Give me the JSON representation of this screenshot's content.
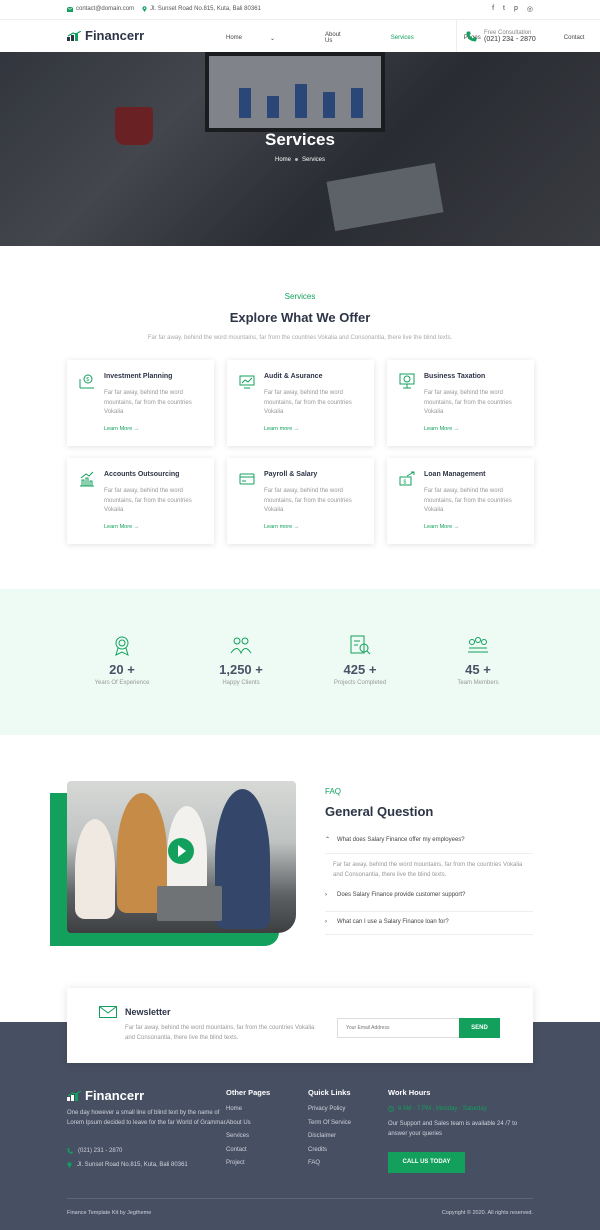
{
  "topbar": {
    "email": "contact@domain.com",
    "address": "Jl. Sunset Road No.815, Kuta, Bali 80361",
    "social": [
      "facebook-icon",
      "twitter-icon",
      "pinterest-icon",
      "instagram-icon"
    ],
    "social_glyphs": [
      "f",
      "t",
      "p",
      "◎"
    ]
  },
  "nav": {
    "logo": "Financerr",
    "items": [
      {
        "label": "Home",
        "dropdown": true
      },
      {
        "label": "About Us",
        "dropdown": false
      },
      {
        "label": "Services",
        "dropdown": false
      },
      {
        "label": "Pages",
        "dropdown": true
      },
      {
        "label": "Contact",
        "dropdown": true
      }
    ],
    "consult_label": "Free Consultation",
    "consult_phone": "(021) 231 - 2870"
  },
  "hero": {
    "title": "Services",
    "breadcrumb": [
      "Home",
      "Services"
    ]
  },
  "services": {
    "tag": "Services",
    "title": "Explore What We Offer",
    "subtitle": "Far far away, behind the word mountains, far from the countries Vokalia and Consonantia, there live the blind texts.",
    "cards": [
      {
        "title": "Investment Planning",
        "desc": "Far far away, behind the word mountains, far from the countries Vokalia",
        "link": "Learn More →",
        "icon": "investment-icon"
      },
      {
        "title": "Audit & Asurance",
        "desc": "Far far away, behind the word mountains, far from the countries Vokalia",
        "link": "Learn more →",
        "icon": "audit-icon"
      },
      {
        "title": "Business Taxation",
        "desc": "Far far away, behind the word mountains, far from the countries Vokalia",
        "link": "Learn More →",
        "icon": "taxation-icon"
      },
      {
        "title": "Accounts Outsourcing",
        "desc": "Far far away, behind the word mountains, far from the countries Vokalia",
        "link": "Learn More →",
        "icon": "accounts-icon"
      },
      {
        "title": "Payroll & Salary",
        "desc": "Far far away, behind the word mountains, far from the countries Vokalia",
        "link": "Learn more →",
        "icon": "payroll-icon"
      },
      {
        "title": "Loan Management",
        "desc": "Far far away, behind the word mountains, far from the countries Vokalia",
        "link": "Learn More →",
        "icon": "loan-icon"
      }
    ]
  },
  "stats": [
    {
      "value": "20 +",
      "label": "Years Of Experience",
      "icon": "award-icon"
    },
    {
      "value": "1,250 +",
      "label": "Happy Clients",
      "icon": "clients-icon"
    },
    {
      "value": "425 +",
      "label": "Projects Completed",
      "icon": "projects-icon"
    },
    {
      "value": "45 +",
      "label": "Team Members",
      "icon": "team-icon"
    }
  ],
  "faq": {
    "tag": "FAQ",
    "title": "General Question",
    "questions": [
      {
        "q": "What does Salary Finance offer my employees?",
        "open": true
      },
      {
        "q": "Does Salary Finance provide customer support?",
        "open": false
      },
      {
        "q": "What can I use a Salary Finance loan for?",
        "open": false
      }
    ],
    "answer": "Far far away, behind the word mountains, far from the countries Vokalia and Consonantia, there live the blind texts."
  },
  "newsletter": {
    "title": "Newsletter",
    "desc": "Far far away, behind the word mountains, far from the countries Vokalia and Consonantia, there live the blind texts.",
    "placeholder": "Your Email Address",
    "button": "SEND"
  },
  "footer": {
    "logo": "Financerr",
    "about": "One day however a small line of blind text by the name of Lorem Ipsum decided to leave for the far World of Grammar.",
    "phone": "(021) 231 - 2870",
    "address": "Jl. Sunset Road No.815, Kuta, Bali 80361",
    "other_pages": {
      "title": "Other Pages",
      "items": [
        "Home",
        "About Us",
        "Services",
        "Contact",
        "Project"
      ]
    },
    "quick_links": {
      "title": "Quick Links",
      "items": [
        "Privacy Policy",
        "Term Of Service",
        "Disclaimer",
        "Credits",
        "FAQ"
      ]
    },
    "work_hours": {
      "title": "Work Hours",
      "time": "8 AM - 7 PM , Monday - Saturday",
      "text": "Our Support and Sales team is available 24 /7 to answer your queries",
      "button": "CALL US TODAY"
    },
    "copyright_left": "Finance Template Kit by Jegtheme",
    "copyright_right": "Copyright © 2020. All rights reserved."
  },
  "colors": {
    "accent": "#12a05c",
    "dark": "#2d3446",
    "footer_bg": "#474f62",
    "stats_bg": "#eefbf5"
  }
}
